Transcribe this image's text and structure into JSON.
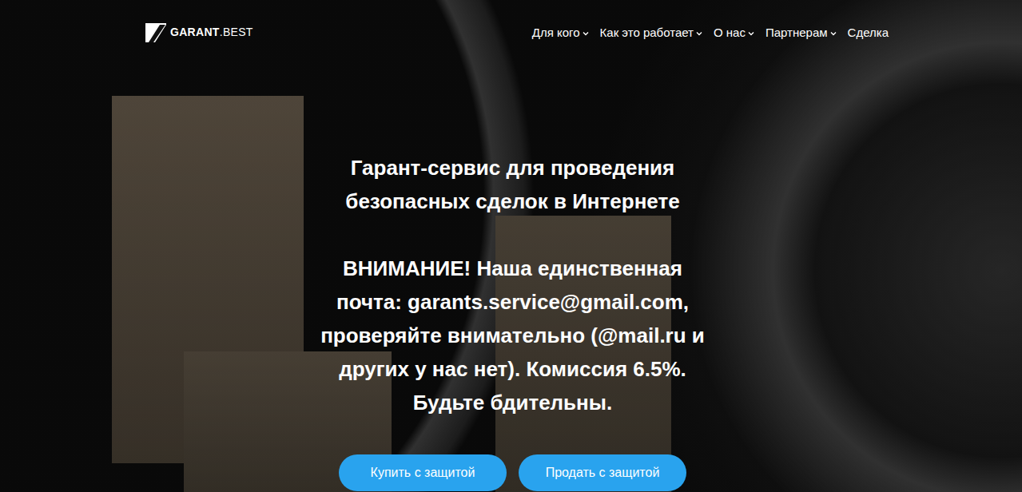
{
  "header": {
    "logo": {
      "name": "GARANT",
      "suffix": ".BEST"
    },
    "nav": [
      {
        "label": "Для кого",
        "dropdown": true
      },
      {
        "label": "Как это работает",
        "dropdown": true
      },
      {
        "label": "О нас",
        "dropdown": true
      },
      {
        "label": "Партнерам",
        "dropdown": true
      },
      {
        "label": "Сделка",
        "dropdown": false
      }
    ]
  },
  "hero": {
    "headline": [
      "Гарант-сервис для проведения",
      "безопасных сделок в Интернете"
    ],
    "notice": [
      "ВНИМАНИЕ! Наша единственная",
      "почта: garants.service@gmail.com,",
      "проверяйте внимательно (@mail.ru и",
      "других у нас нет). Комиссия 6.5%.",
      "Будьте бдительны."
    ],
    "buttons": [
      "Купить с защитой",
      "Продать с защитой"
    ]
  }
}
